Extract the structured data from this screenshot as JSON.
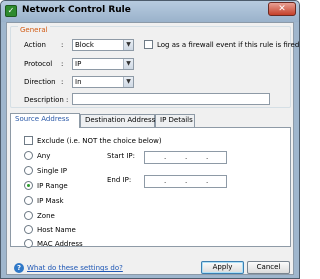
{
  "window": {
    "title": "Network Control Rule",
    "close_glyph": "✕",
    "app_icon_glyph": "✓"
  },
  "general": {
    "legend": "General",
    "action": {
      "label": "Action",
      "colon": ":",
      "value": "Block"
    },
    "log_checkbox": {
      "label": "Log as a firewall event if this rule is fired",
      "checked": false
    },
    "protocol": {
      "label": "Protocol",
      "colon": ":",
      "value": "IP"
    },
    "direction": {
      "label": "Direction",
      "colon": ":",
      "value": "In"
    },
    "description": {
      "label": "Description",
      "colon": ":",
      "value": ""
    },
    "dropdown_arrow": "▼"
  },
  "tabs": [
    {
      "label": "Source Address",
      "active": true
    },
    {
      "label": "Destination Address",
      "active": false
    },
    {
      "label": "IP Details",
      "active": false
    }
  ],
  "source": {
    "exclude_label": "Exclude (i.e. NOT the choice below)",
    "exclude_checked": false,
    "options": [
      "Any",
      "Single IP",
      "IP Range",
      "IP Mask",
      "Zone",
      "Host Name",
      "MAC Address"
    ],
    "selected_option": "IP Range",
    "start_ip_label": "Start IP:",
    "end_ip_label": "End IP:",
    "ip_separator": "."
  },
  "footer": {
    "help_icon_glyph": "?",
    "help_link": "What do these settings do?",
    "apply_label": "Apply",
    "cancel_label": "Cancel"
  }
}
